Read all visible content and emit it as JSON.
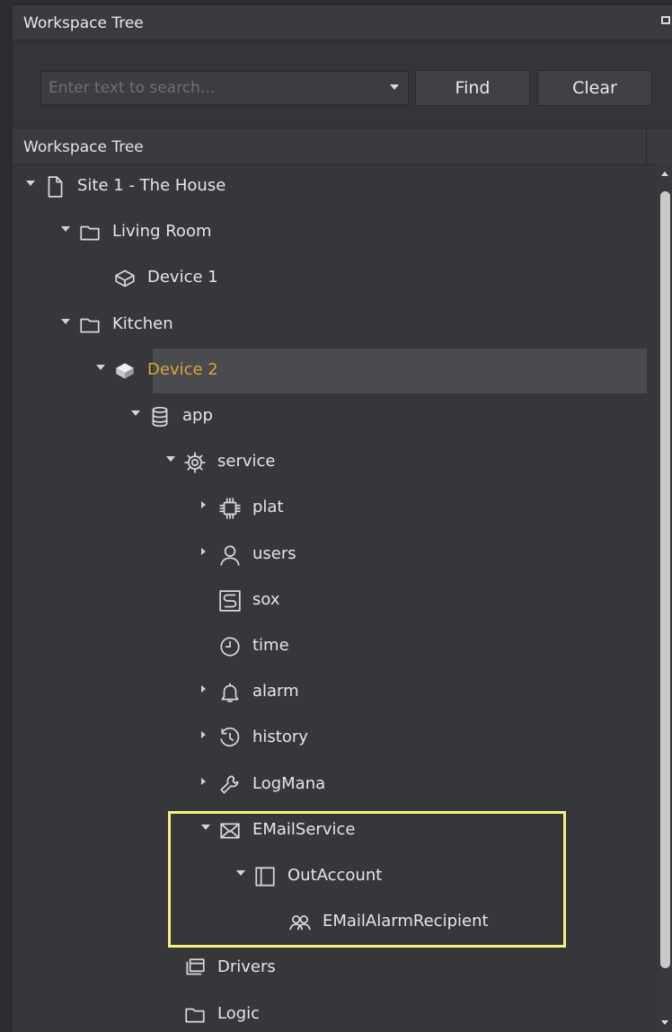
{
  "panel": {
    "title": "Workspace Tree",
    "column_header": "Workspace Tree"
  },
  "search": {
    "placeholder": "Enter text to search...",
    "find_label": "Find",
    "clear_label": "Clear"
  },
  "colors": {
    "selected_text": "#e0a33a",
    "highlight_box": "#f6f27c"
  },
  "tree": [
    {
      "label": "Site 1 - The House",
      "icon": "file-icon",
      "level": 0,
      "expander": "down"
    },
    {
      "label": "Living Room",
      "icon": "folder-icon",
      "level": 1,
      "expander": "down"
    },
    {
      "label": "Device 1",
      "icon": "device-outline-icon",
      "level": 2,
      "expander": "none"
    },
    {
      "label": "Kitchen",
      "icon": "folder-icon",
      "level": 1,
      "expander": "down"
    },
    {
      "label": "Device 2",
      "icon": "device-filled-icon",
      "level": 2,
      "expander": "down",
      "selected": true
    },
    {
      "label": "app",
      "icon": "database-icon",
      "level": 3,
      "expander": "down"
    },
    {
      "label": "service",
      "icon": "gear-icon",
      "level": 4,
      "expander": "down"
    },
    {
      "label": "plat",
      "icon": "chip-icon",
      "level": 5,
      "expander": "right"
    },
    {
      "label": "users",
      "icon": "user-icon",
      "level": 5,
      "expander": "right"
    },
    {
      "label": "sox",
      "icon": "sox-icon",
      "level": 5,
      "expander": "none"
    },
    {
      "label": "time",
      "icon": "clock-icon",
      "level": 5,
      "expander": "none"
    },
    {
      "label": "alarm",
      "icon": "bell-icon",
      "level": 5,
      "expander": "right"
    },
    {
      "label": "history",
      "icon": "history-icon",
      "level": 5,
      "expander": "right"
    },
    {
      "label": "LogMana",
      "icon": "wrench-icon",
      "level": 5,
      "expander": "right"
    },
    {
      "label": "EMailService",
      "icon": "envelope-icon",
      "level": 5,
      "expander": "down"
    },
    {
      "label": "OutAccount",
      "icon": "account-icon",
      "level": 6,
      "expander": "down"
    },
    {
      "label": "EMailAlarmRecipient",
      "icon": "recipients-icon",
      "level": 7,
      "expander": "none"
    },
    {
      "label": "Drivers",
      "icon": "drivers-icon",
      "level": 4,
      "expander": "none"
    },
    {
      "label": "Logic",
      "icon": "folder-icon",
      "level": 4,
      "expander": "none"
    }
  ]
}
